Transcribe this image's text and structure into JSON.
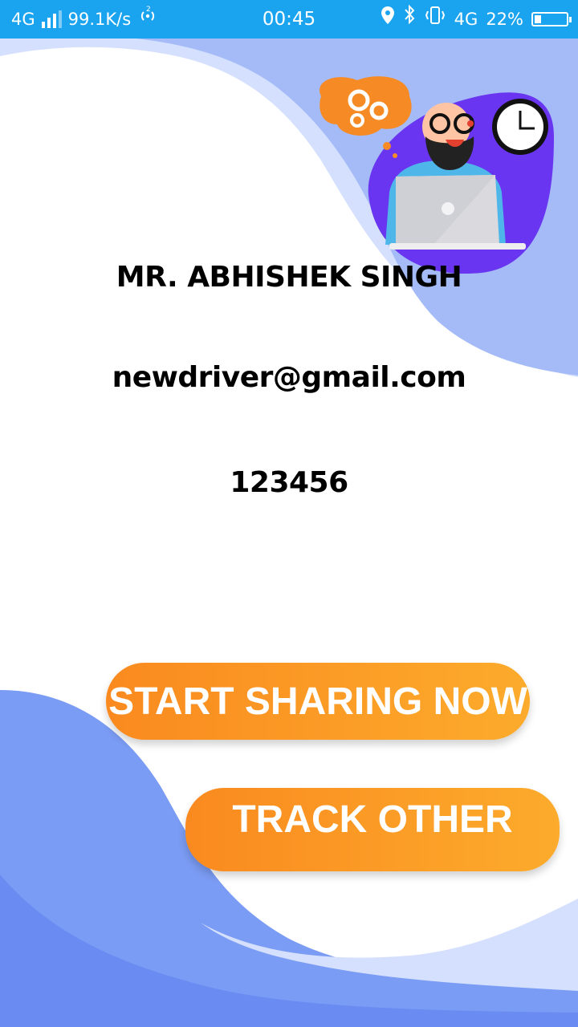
{
  "status_bar": {
    "network": "4G",
    "speed": "99.1K/s",
    "hotspot_icon": "hotspot-icon",
    "time": "00:45",
    "icons": [
      "location-icon",
      "bluetooth-icon",
      "vibrate-icon"
    ],
    "network_right": "4G",
    "battery_text": "22%",
    "battery_level": 0.22
  },
  "illustration": {
    "icon": "man-with-laptop-illustration",
    "elements": [
      "gears-icon",
      "clock-icon",
      "laptop-icon"
    ]
  },
  "profile": {
    "name": "MR. ABHISHEK SINGH",
    "email": "newdriver@gmail.com",
    "code": "123456"
  },
  "actions": {
    "start_label": "START SHARING NOW",
    "track_label": "TRACK OTHER"
  },
  "colors": {
    "status_bar": "#1aa3ef",
    "wave_dark": "#7b9cf4",
    "wave_light": "#d4e0fd",
    "button_start": "#fa8a1f",
    "button_end": "#fcab2c",
    "illustration_blob": "#6a35f0"
  }
}
